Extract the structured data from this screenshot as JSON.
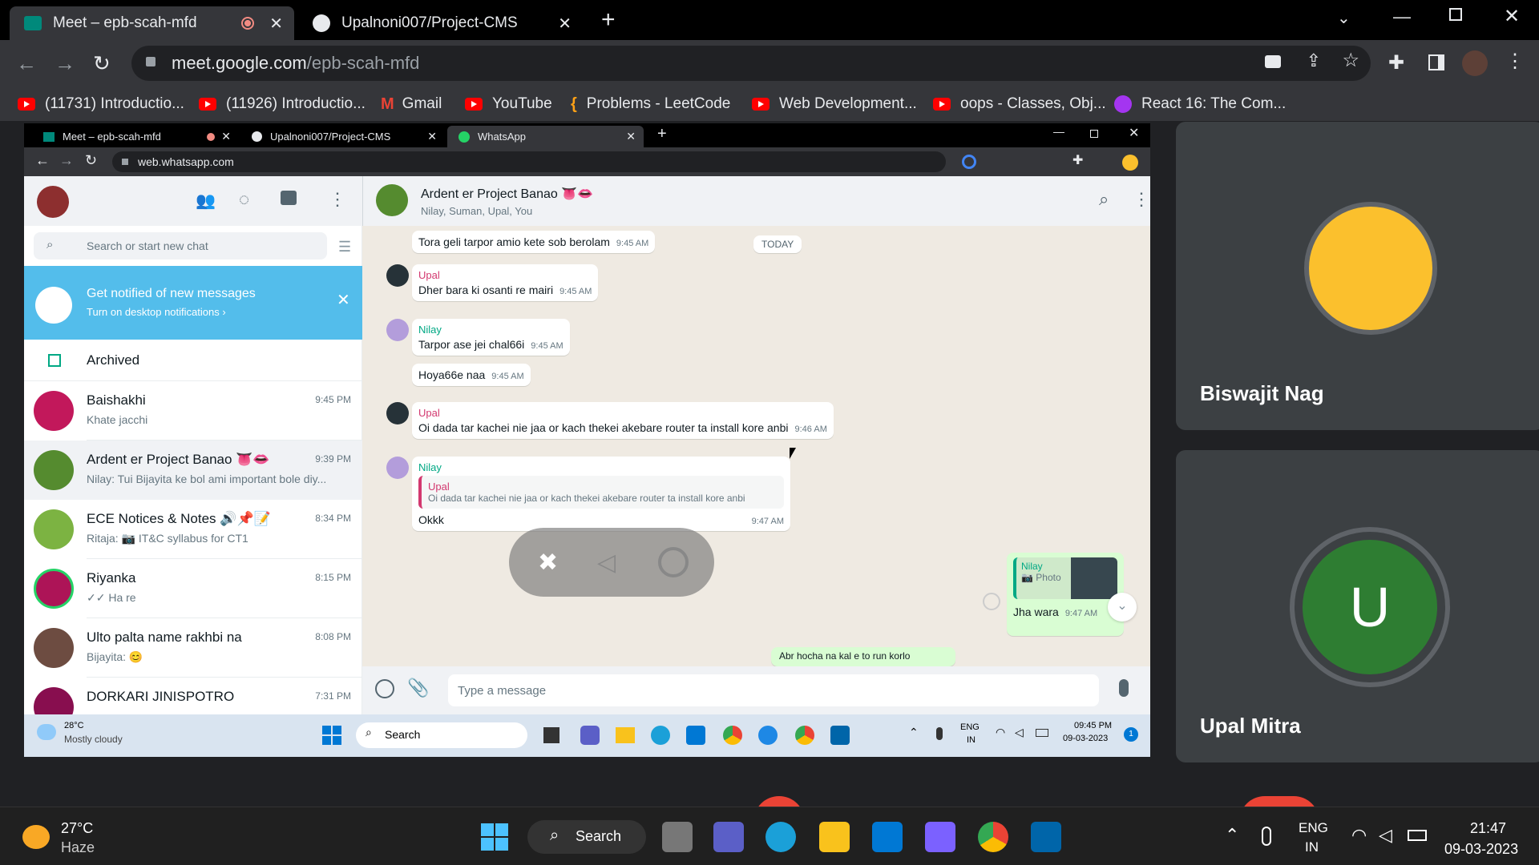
{
  "outer_browser": {
    "tabs": [
      {
        "title": "Meet – epb-scah-mfd",
        "recording": true
      },
      {
        "title": "Upalnoni007/Project-CMS"
      }
    ],
    "url_host": "meet.google.com",
    "url_path": "/epb-scah-mfd",
    "bookmarks": [
      {
        "label": "(11731) Introductio...",
        "icon": "youtube-icon"
      },
      {
        "label": "(11926) Introductio...",
        "icon": "youtube-icon"
      },
      {
        "label": "Gmail",
        "icon": "gmail-icon"
      },
      {
        "label": "YouTube",
        "icon": "youtube-icon"
      },
      {
        "label": "Problems - LeetCode",
        "icon": "leetcode-icon"
      },
      {
        "label": "Web Development...",
        "icon": "youtube-icon"
      },
      {
        "label": "oops - Classes, Obj...",
        "icon": "youtube-icon"
      },
      {
        "label": "React 16: The Com...",
        "icon": "udemy-icon"
      }
    ]
  },
  "inner_browser": {
    "tabs": [
      {
        "title": "Meet – epb-scah-mfd"
      },
      {
        "title": "Upalnoni007/Project-CMS"
      },
      {
        "title": "WhatsApp"
      }
    ],
    "url": "web.whatsapp.com"
  },
  "whatsapp": {
    "search_placeholder": "Search or start new chat",
    "notification": {
      "title": "Get notified of new messages",
      "link": "Turn on desktop notifications ›"
    },
    "archived_label": "Archived",
    "chats": [
      {
        "name": "Baishakhi",
        "preview": "Khate jacchi",
        "time": "9:45 PM",
        "color": "#c2185b"
      },
      {
        "name": "Ardent er Project Banao 👅👄",
        "preview": "Nilay: Tui Bijayita ke bol ami important bole diy...",
        "time": "9:39 PM",
        "color": "#558b2f",
        "active": true
      },
      {
        "name": "ECE Notices & Notes 🔊📌📝",
        "preview": "Ritaja: 📷 IT&C syllabus for CT1",
        "time": "8:34 PM",
        "color": "#7cb342"
      },
      {
        "name": "Riyanka",
        "preview": "✓✓ Ha re",
        "time": "8:15 PM",
        "color": "#ad1457"
      },
      {
        "name": "Ulto palta name rakhbi na",
        "preview": "Bijayita: 😊",
        "time": "8:08 PM",
        "color": "#6d4c41"
      },
      {
        "name": "DORKARI JINISPOTRO",
        "preview": "",
        "time": "7:31 PM",
        "color": "#880e4f"
      }
    ],
    "conversation": {
      "name": "Ardent er Project Banao 👅👄",
      "members": "Nilay, Suman, Upal, You",
      "today_label": "TODAY",
      "messages": [
        {
          "sender": "",
          "text": "Tora geli tarpor amio kete sob berolam",
          "time": "9:45 AM"
        },
        {
          "sender": "Upal",
          "text": "Dher bara ki osanti re mairi",
          "time": "9:45 AM"
        },
        {
          "sender": "Nilay",
          "text": "Tarpor ase jei chal66i",
          "time": "9:45 AM"
        },
        {
          "sender": "",
          "text": "Hoya66e naa",
          "time": "9:45 AM"
        },
        {
          "sender": "Upal",
          "text": "Oi dada tar kachei nie jaa or kach thekei akebare router ta install kore anbi",
          "time": "9:46 AM"
        },
        {
          "sender": "Nilay",
          "quote_sender": "Upal",
          "quote": "Oi dada tar kachei nie jaa or kach thekei akebare router ta install kore anbi",
          "text": "Okkk",
          "time": "9:47 AM"
        }
      ],
      "outgoing": {
        "quote_sender": "Nilay",
        "quote": "📷 Photo",
        "text": "Jha wara",
        "time": "9:47 AM"
      },
      "partial_text": "Abr hocha na kal e to run korlo",
      "composer_placeholder": "Type a message"
    },
    "taskbar": {
      "temp": "28°C",
      "weather": "Mostly cloudy",
      "search": "Search",
      "lang1": "ENG",
      "lang2": "IN",
      "time": "09:45 PM",
      "date": "09-03-2023",
      "badge": "1"
    }
  },
  "meet": {
    "participants": [
      {
        "name": "Biswajit Nag"
      },
      {
        "name": "Upal Mitra",
        "initial": "U",
        "color": "#2e7d32"
      }
    ]
  },
  "outer_taskbar": {
    "temp": "27°C",
    "weather": "Haze",
    "search": "Search",
    "lang1": "ENG",
    "lang2": "IN",
    "time": "21:47",
    "date": "09-03-2023"
  }
}
